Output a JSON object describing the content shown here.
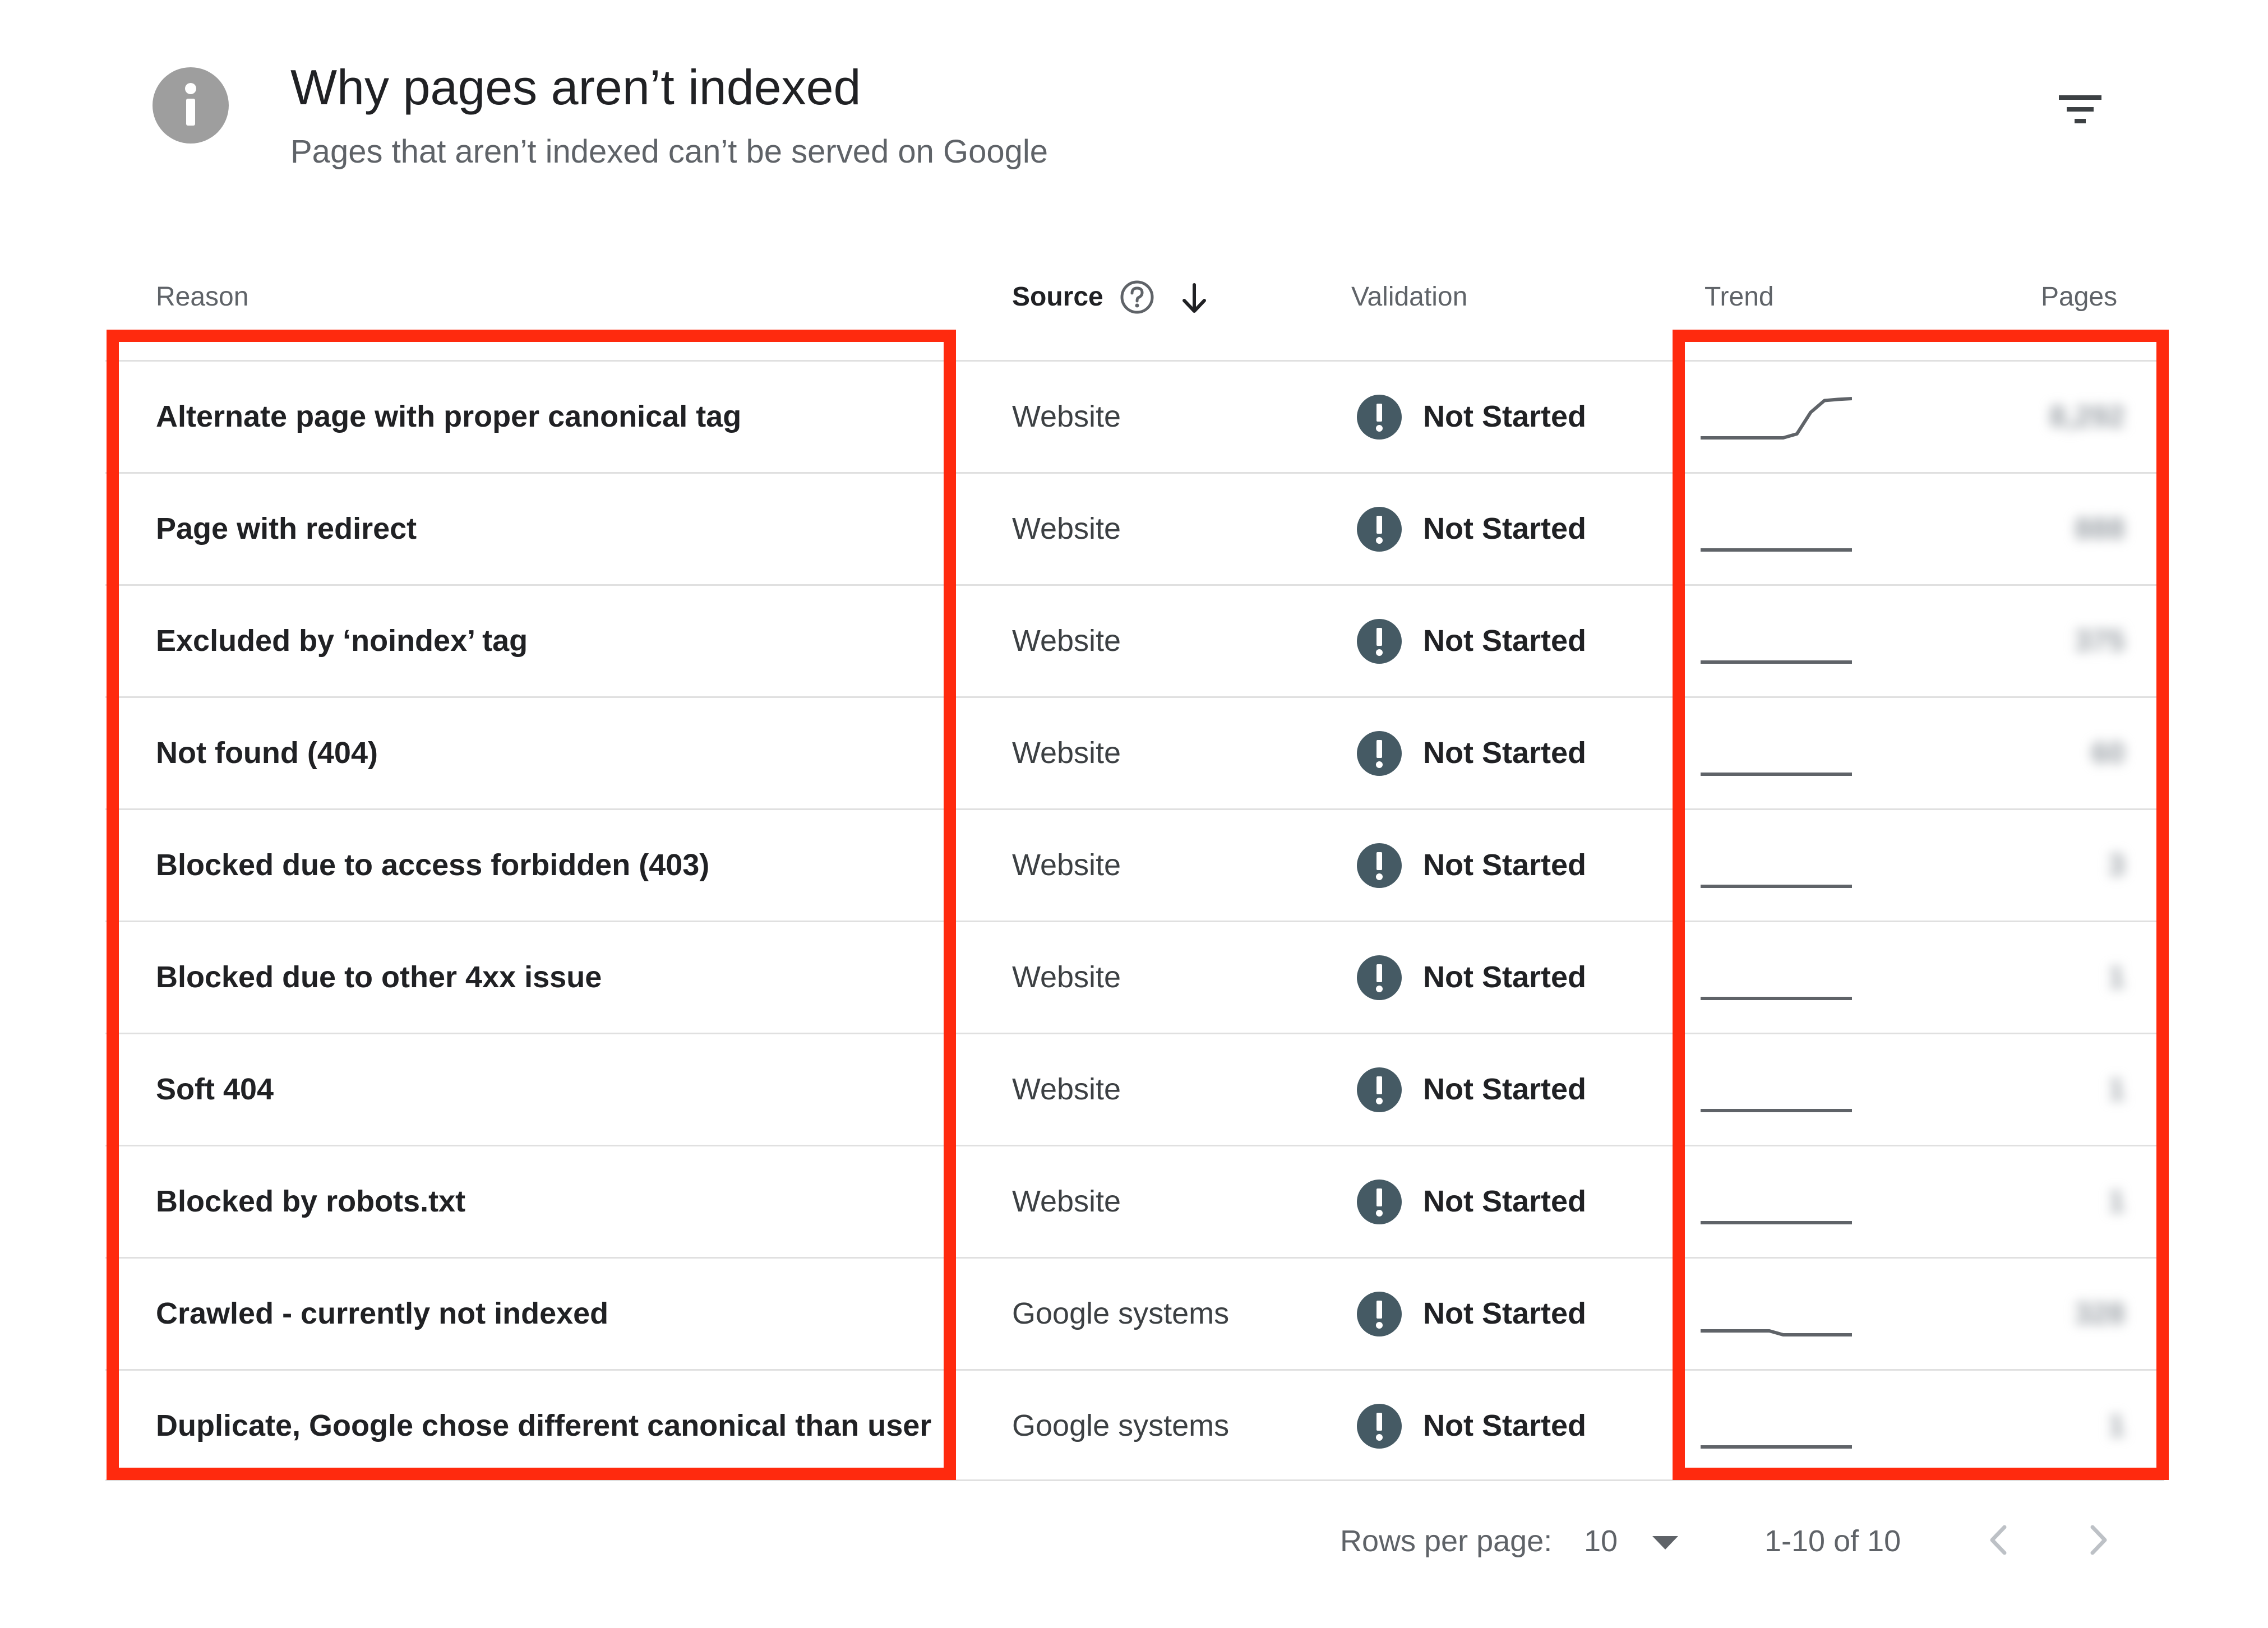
{
  "header": {
    "title": "Why pages aren’t indexed",
    "subtitle": "Pages that aren’t indexed can’t be served on Google",
    "icons": {
      "info": "info-icon",
      "filter": "filter-icon"
    }
  },
  "columns": {
    "reason": "Reason",
    "source": "Source",
    "validation": "Validation",
    "trend": "Trend",
    "pages": "Pages",
    "source_icons": [
      "help-circle-icon",
      "arrow-down-icon"
    ]
  },
  "rows": [
    {
      "reason": "Alternate page with proper canonical tag",
      "source": "Website",
      "validation": "Not Started",
      "pages": "8,292",
      "trend": [
        0,
        0,
        0,
        0,
        0,
        0,
        0,
        0.1,
        0.65,
        0.95,
        0.98,
        1
      ]
    },
    {
      "reason": "Page with redirect",
      "source": "Website",
      "validation": "Not Started",
      "pages": "888",
      "trend": [
        0,
        0,
        0,
        0,
        0,
        0,
        0,
        0,
        0,
        0,
        0,
        0
      ]
    },
    {
      "reason": "Excluded by ‘noindex’ tag",
      "source": "Website",
      "validation": "Not Started",
      "pages": "375",
      "trend": [
        0,
        0,
        0,
        0,
        0,
        0,
        0,
        0,
        0,
        0,
        0,
        0
      ]
    },
    {
      "reason": "Not found (404)",
      "source": "Website",
      "validation": "Not Started",
      "pages": "60",
      "trend": [
        0,
        0,
        0,
        0,
        0,
        0,
        0,
        0,
        0,
        0,
        0,
        0
      ]
    },
    {
      "reason": "Blocked due to access forbidden (403)",
      "source": "Website",
      "validation": "Not Started",
      "pages": "3",
      "trend": [
        0,
        0,
        0,
        0,
        0,
        0,
        0,
        0,
        0,
        0,
        0,
        0
      ]
    },
    {
      "reason": "Blocked due to other 4xx issue",
      "source": "Website",
      "validation": "Not Started",
      "pages": "1",
      "trend": [
        0,
        0,
        0,
        0,
        0,
        0,
        0,
        0,
        0,
        0,
        0,
        0
      ]
    },
    {
      "reason": "Soft 404",
      "source": "Website",
      "validation": "Not Started",
      "pages": "1",
      "trend": [
        0,
        0,
        0,
        0,
        0,
        0,
        0,
        0,
        0,
        0,
        0,
        0
      ]
    },
    {
      "reason": "Blocked by robots.txt",
      "source": "Website",
      "validation": "Not Started",
      "pages": "1",
      "trend": [
        0,
        0,
        0,
        0,
        0,
        0,
        0,
        0,
        0,
        0,
        0,
        0
      ]
    },
    {
      "reason": "Crawled - currently not indexed",
      "source": "Google systems",
      "validation": "Not Started",
      "pages": "328",
      "trend": [
        0.1,
        0.1,
        0.1,
        0.1,
        0.1,
        0.1,
        0,
        0,
        0,
        0,
        0,
        0
      ]
    },
    {
      "reason": "Duplicate, Google chose different canonical than user",
      "source": "Google systems",
      "validation": "Not Started",
      "pages": "1",
      "trend": [
        0,
        0,
        0,
        0,
        0,
        0,
        0,
        0,
        0,
        0,
        0,
        0
      ]
    }
  ],
  "pagination": {
    "rows_per_page_label": "Rows per page:",
    "rows_per_page_value": "10",
    "range": "1-10 of 10",
    "icons": [
      "chevron-left-icon",
      "chevron-right-icon"
    ]
  },
  "colors": {
    "highlight": "#ff2a0e",
    "validation_icon": "#455a64",
    "trend_line": "#5f6368",
    "info_icon": "#9e9e9e"
  }
}
